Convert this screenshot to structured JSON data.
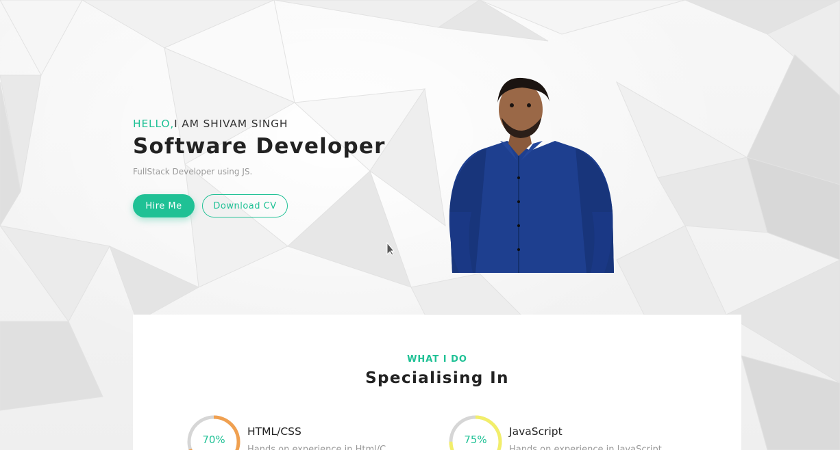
{
  "hero": {
    "greeting_highlight": "HELLO,",
    "greeting_name": "I AM SHIVAM SINGH",
    "role": "Software Developer",
    "tagline": "FullStack Developer using JS.",
    "primary_button": "Hire Me",
    "secondary_button": "Download CV"
  },
  "services": {
    "eyebrow": "WHAT I DO",
    "title": "Specialising In",
    "skills": [
      {
        "name": "HTML/CSS",
        "percent_label": "70%",
        "percent": 70,
        "color": "#f0a050",
        "description": "Hands on experience in Html/C"
      },
      {
        "name": "JavaScript",
        "percent_label": "75%",
        "percent": 75,
        "color": "#f2ee6a",
        "description": "Hands on experience in JavaScript"
      }
    ]
  },
  "colors": {
    "accent": "#1fc195",
    "text": "#222222",
    "muted": "#9a9a9a"
  }
}
